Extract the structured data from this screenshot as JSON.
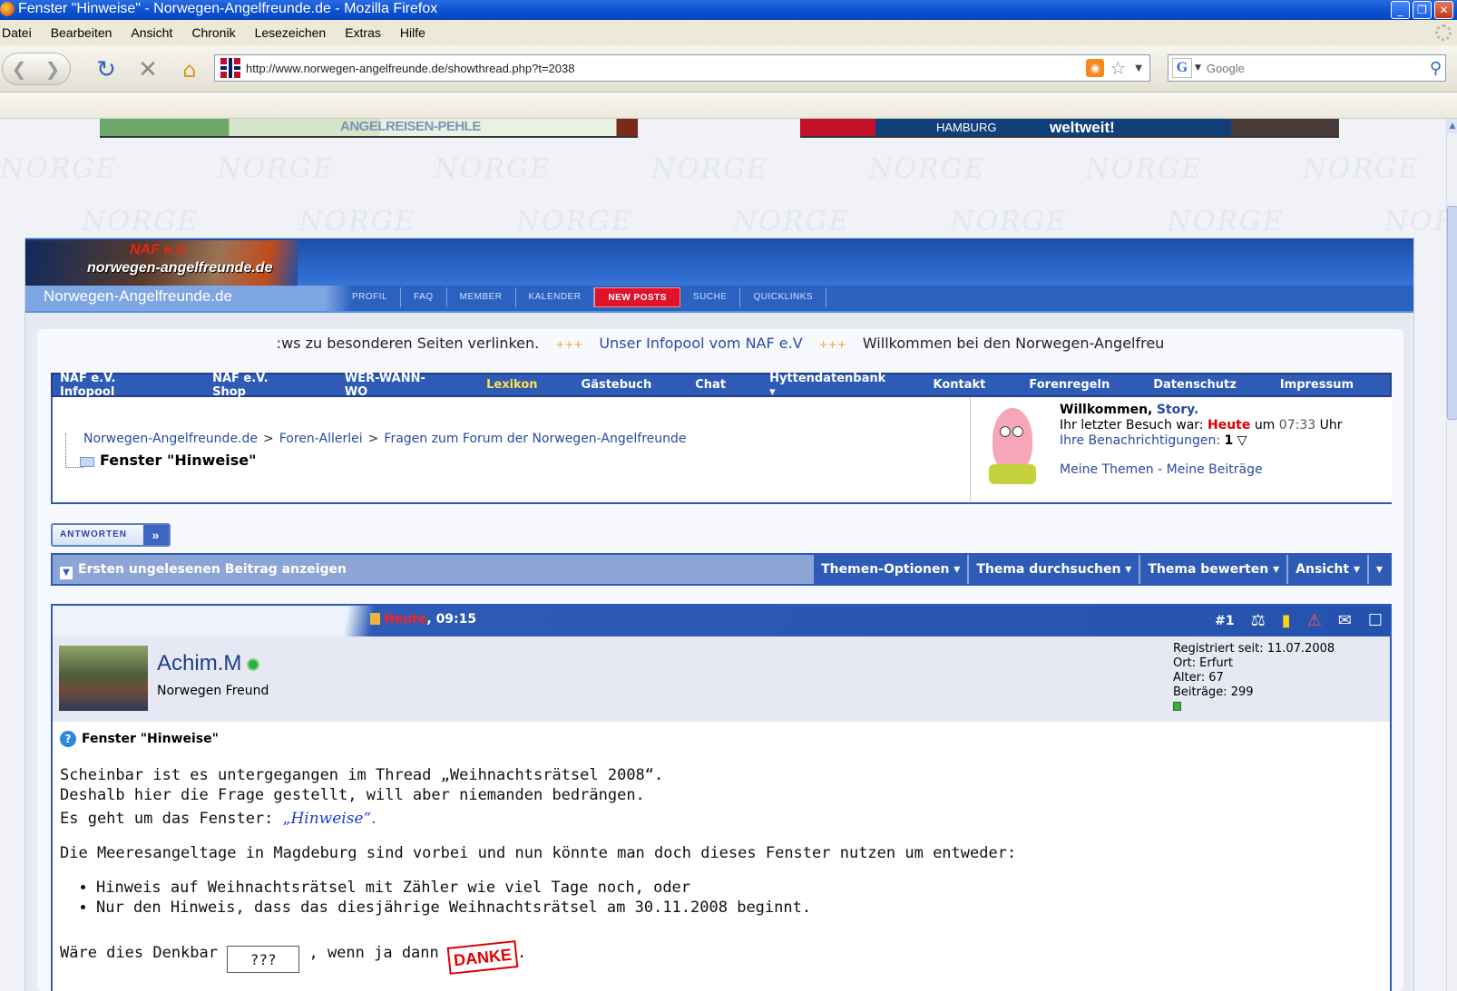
{
  "window": {
    "title": "Fenster \"Hinweise\" - Norwegen-Angelfreunde.de - Mozilla Firefox",
    "minimize": "_",
    "restore": "❐",
    "close": "✕"
  },
  "menu": [
    "Datei",
    "Bearbeiten",
    "Ansicht",
    "Chronik",
    "Lesezeichen",
    "Extras",
    "Hilfe"
  ],
  "toolbar": {
    "url": "http://www.norwegen-angelfreunde.de/showthread.php?t=2038",
    "search_placeholder": "Google"
  },
  "banners": {
    "left_text": "ANGELREISEN-PEHLE",
    "right_city": "HAMBURG",
    "right_slogan": "weltweit!"
  },
  "watermark": "NORGE",
  "header": {
    "logo_naf": "NAF e.V.",
    "logo_domain": "norwegen-angelfreunde.de",
    "site_name": "Norwegen-Angelfreunde.de",
    "nav": [
      "PROFIL",
      "FAQ",
      "MEMBER",
      "KALENDER",
      "NEW POSTS",
      "SUCHE",
      "QUICKLINKS"
    ]
  },
  "ticker": {
    "part1": ":ws zu besonderen Seiten verlinken.",
    "sep": "+++",
    "part2": "Unser Infopool vom NAF e.V",
    "part3": "Willkommen bei den Norwegen-Angelfreu"
  },
  "linkbar": [
    "NAF e.V. Infopool",
    "NAF e.V. Shop",
    "WER-WANN-WO",
    "Lexikon",
    "Gästebuch",
    "Chat",
    "Hyttendatenbank ▾",
    "Kontakt",
    "Forenregeln",
    "Datenschutz",
    "Impressum"
  ],
  "breadcrumb": {
    "items": [
      "Norwegen-Angelfreunde.de",
      "Foren-Allerlei",
      "Fragen zum Forum der Norwegen-Angelfreunde"
    ],
    "sep": ">",
    "current": "Fenster \"Hinweise\""
  },
  "welcome": {
    "greeting": "Willkommen,",
    "user": "Story.",
    "last_visit_label": "Ihr letzter Besuch war:",
    "last_visit_day": "Heute",
    "last_visit_at": "um",
    "last_visit_time": "07:33",
    "last_visit_unit": "Uhr",
    "notifications_label": "Ihre Benachrichtigungen:",
    "notifications_count": "1",
    "my_threads": "Meine Themen",
    "dash": "-",
    "my_posts": "Meine Beiträge"
  },
  "reply_button": "ANTWORTEN",
  "threadtools": {
    "first_unread": "Ersten ungelesenen Beitrag anzeigen",
    "tools": [
      "Themen-Optionen ▾",
      "Thema durchsuchen ▾",
      "Thema bewerten ▾",
      "Ansicht ▾",
      "▾"
    ]
  },
  "post": {
    "date_day": "Heute",
    "date_time": ", 09:15",
    "number": "#1",
    "author": "Achim.M",
    "author_title": "Norwegen Freund",
    "registered": "Registriert seit: 11.07.2008",
    "location": "Ort: Erfurt",
    "age": "Alter: 67",
    "posts": "Beiträge: 299",
    "title": "Fenster \"Hinweise\"",
    "line1": "Scheinbar ist es untergegangen im Thread „Weihnachtsrätsel 2008“.",
    "line2": "Deshalb hier die Frage gestellt, will aber niemanden bedrängen.",
    "line3_pre": "Es geht um das Fenster: ",
    "line3_link": "„Hinweise“.",
    "line4": "Die Meeresangeltage in Magdeburg sind vorbei und nun könnte man doch dieses Fenster nutzen um entweder:",
    "bullets": [
      "Hinweis auf Weihnachtsrätsel mit Zähler wie viel Tage noch, oder",
      "Nur den Hinweis, dass das diesjährige Weihnachtsrätsel am 30.11.2008 beginnt."
    ],
    "last_pre": "Wäre dies Denkbar ",
    "sign_text": "???",
    "last_mid": " , wenn ja dann ",
    "danke": "DANKE",
    "last_end": "."
  }
}
